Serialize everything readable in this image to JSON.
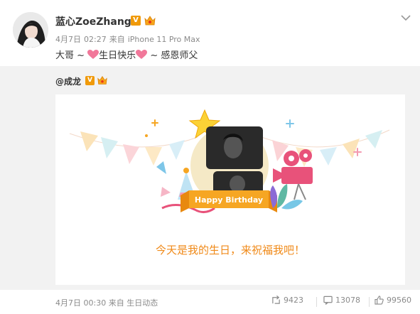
{
  "post": {
    "username": "蓝心ZoeZhang",
    "verified_badge": "V",
    "meta": {
      "date": "4月7日",
      "time": "02:27",
      "source_prefix": "来自",
      "device": "iPhone 11 Pro Max"
    },
    "content": {
      "part1": "大哥 ~ ",
      "part2": "生日快乐",
      "part3": " ~ 感恩师父"
    }
  },
  "repost": {
    "mention": "@成龙",
    "verified_badge": "V",
    "card": {
      "banner_text": "Happy Birthday",
      "wish": "今天是我的生日，来祝福我吧！"
    },
    "footer": {
      "date": "4月7日",
      "time": "00:30",
      "source_prefix": "来自",
      "source": "生日动态",
      "reposts": "9423",
      "comments": "13078",
      "likes": "99560"
    }
  },
  "icons": [
    "crown-icon",
    "chevron-down-icon",
    "heart-emoji-icon",
    "repost-icon",
    "comment-icon",
    "like-icon"
  ],
  "colors": {
    "accent_orange": "#f08a19",
    "badge_orange": "#f09a0a",
    "meta_gray": "#8a8a8a",
    "repost_bg": "#f2f2f2"
  }
}
